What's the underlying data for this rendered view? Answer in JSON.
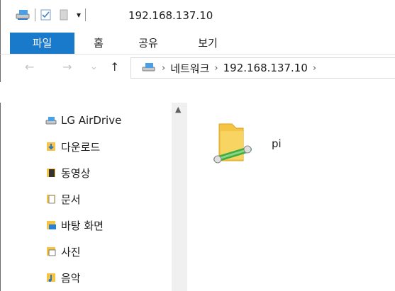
{
  "window": {
    "title": "192.168.137.10"
  },
  "quick_access": {
    "dropdown": "▾"
  },
  "ribbon": {
    "tabs": [
      "파일",
      "홈",
      "공유",
      "보기"
    ],
    "active": "파일"
  },
  "nav": {
    "back": "←",
    "forward": "→",
    "recent": "⌄",
    "up": "↑",
    "breadcrumb": [
      "네트워크",
      "192.168.137.10"
    ],
    "crumb_separator": "›"
  },
  "sidebar": {
    "items": [
      {
        "label": "LG AirDrive",
        "icon": "network-drive-icon"
      },
      {
        "label": "다운로드",
        "icon": "downloads-folder-icon"
      },
      {
        "label": "동영상",
        "icon": "videos-folder-icon"
      },
      {
        "label": "문서",
        "icon": "documents-folder-icon"
      },
      {
        "label": "바탕 화면",
        "icon": "desktop-folder-icon"
      },
      {
        "label": "사진",
        "icon": "pictures-folder-icon"
      },
      {
        "label": "음악",
        "icon": "music-folder-icon"
      }
    ]
  },
  "content": {
    "items": [
      {
        "label": "pi",
        "icon": "network-share-folder-icon"
      }
    ]
  },
  "colors": {
    "accent": "#1979ca",
    "folder": "#f5c443",
    "network_pipe": "#3fae3f"
  }
}
